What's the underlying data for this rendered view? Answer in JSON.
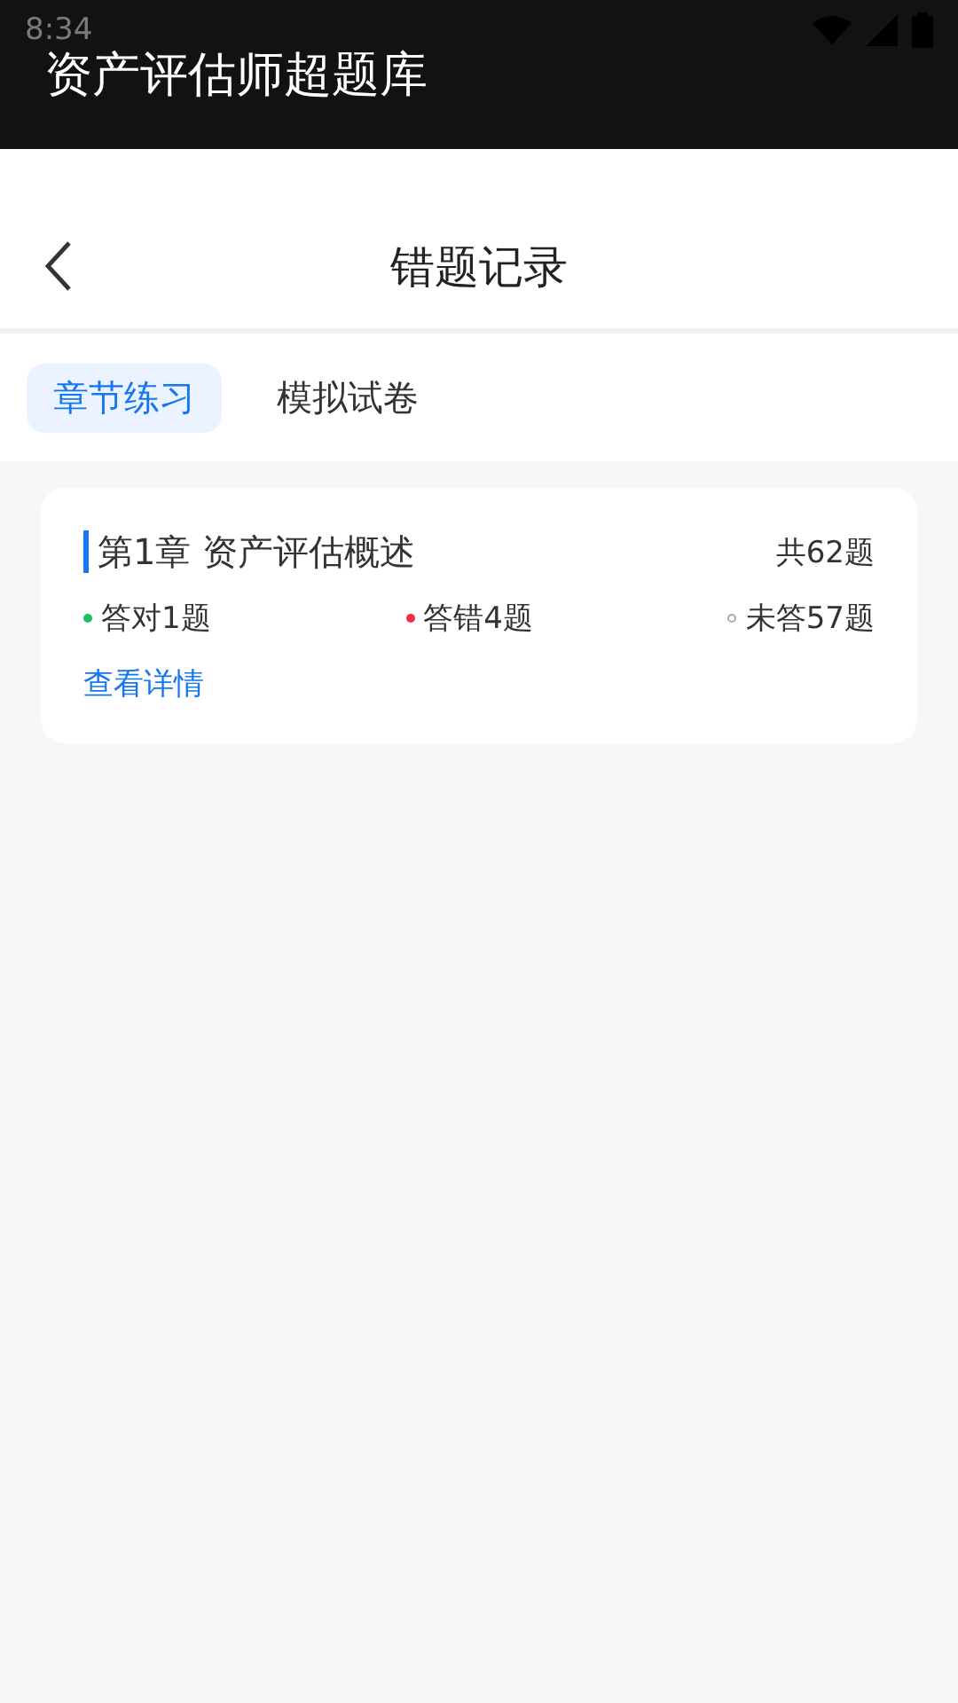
{
  "status_bar": {
    "time": "8:34"
  },
  "app_bar": {
    "title": "资产评估师超题库"
  },
  "nav": {
    "title": "错题记录"
  },
  "tabs": [
    {
      "label": "章节练习",
      "selected": true
    },
    {
      "label": "模拟试卷",
      "selected": false
    }
  ],
  "chapters": [
    {
      "title": "第1章 资产评估概述",
      "total": "共62题",
      "stats": [
        {
          "label": "答对1题",
          "kind": "filled",
          "color": "#1dbf5e"
        },
        {
          "label": "答错4题",
          "kind": "filled",
          "color": "#f0304a"
        },
        {
          "label": "未答57题",
          "kind": "hollow",
          "color": "#a8a8a8"
        }
      ],
      "link": "查看详情"
    }
  ]
}
